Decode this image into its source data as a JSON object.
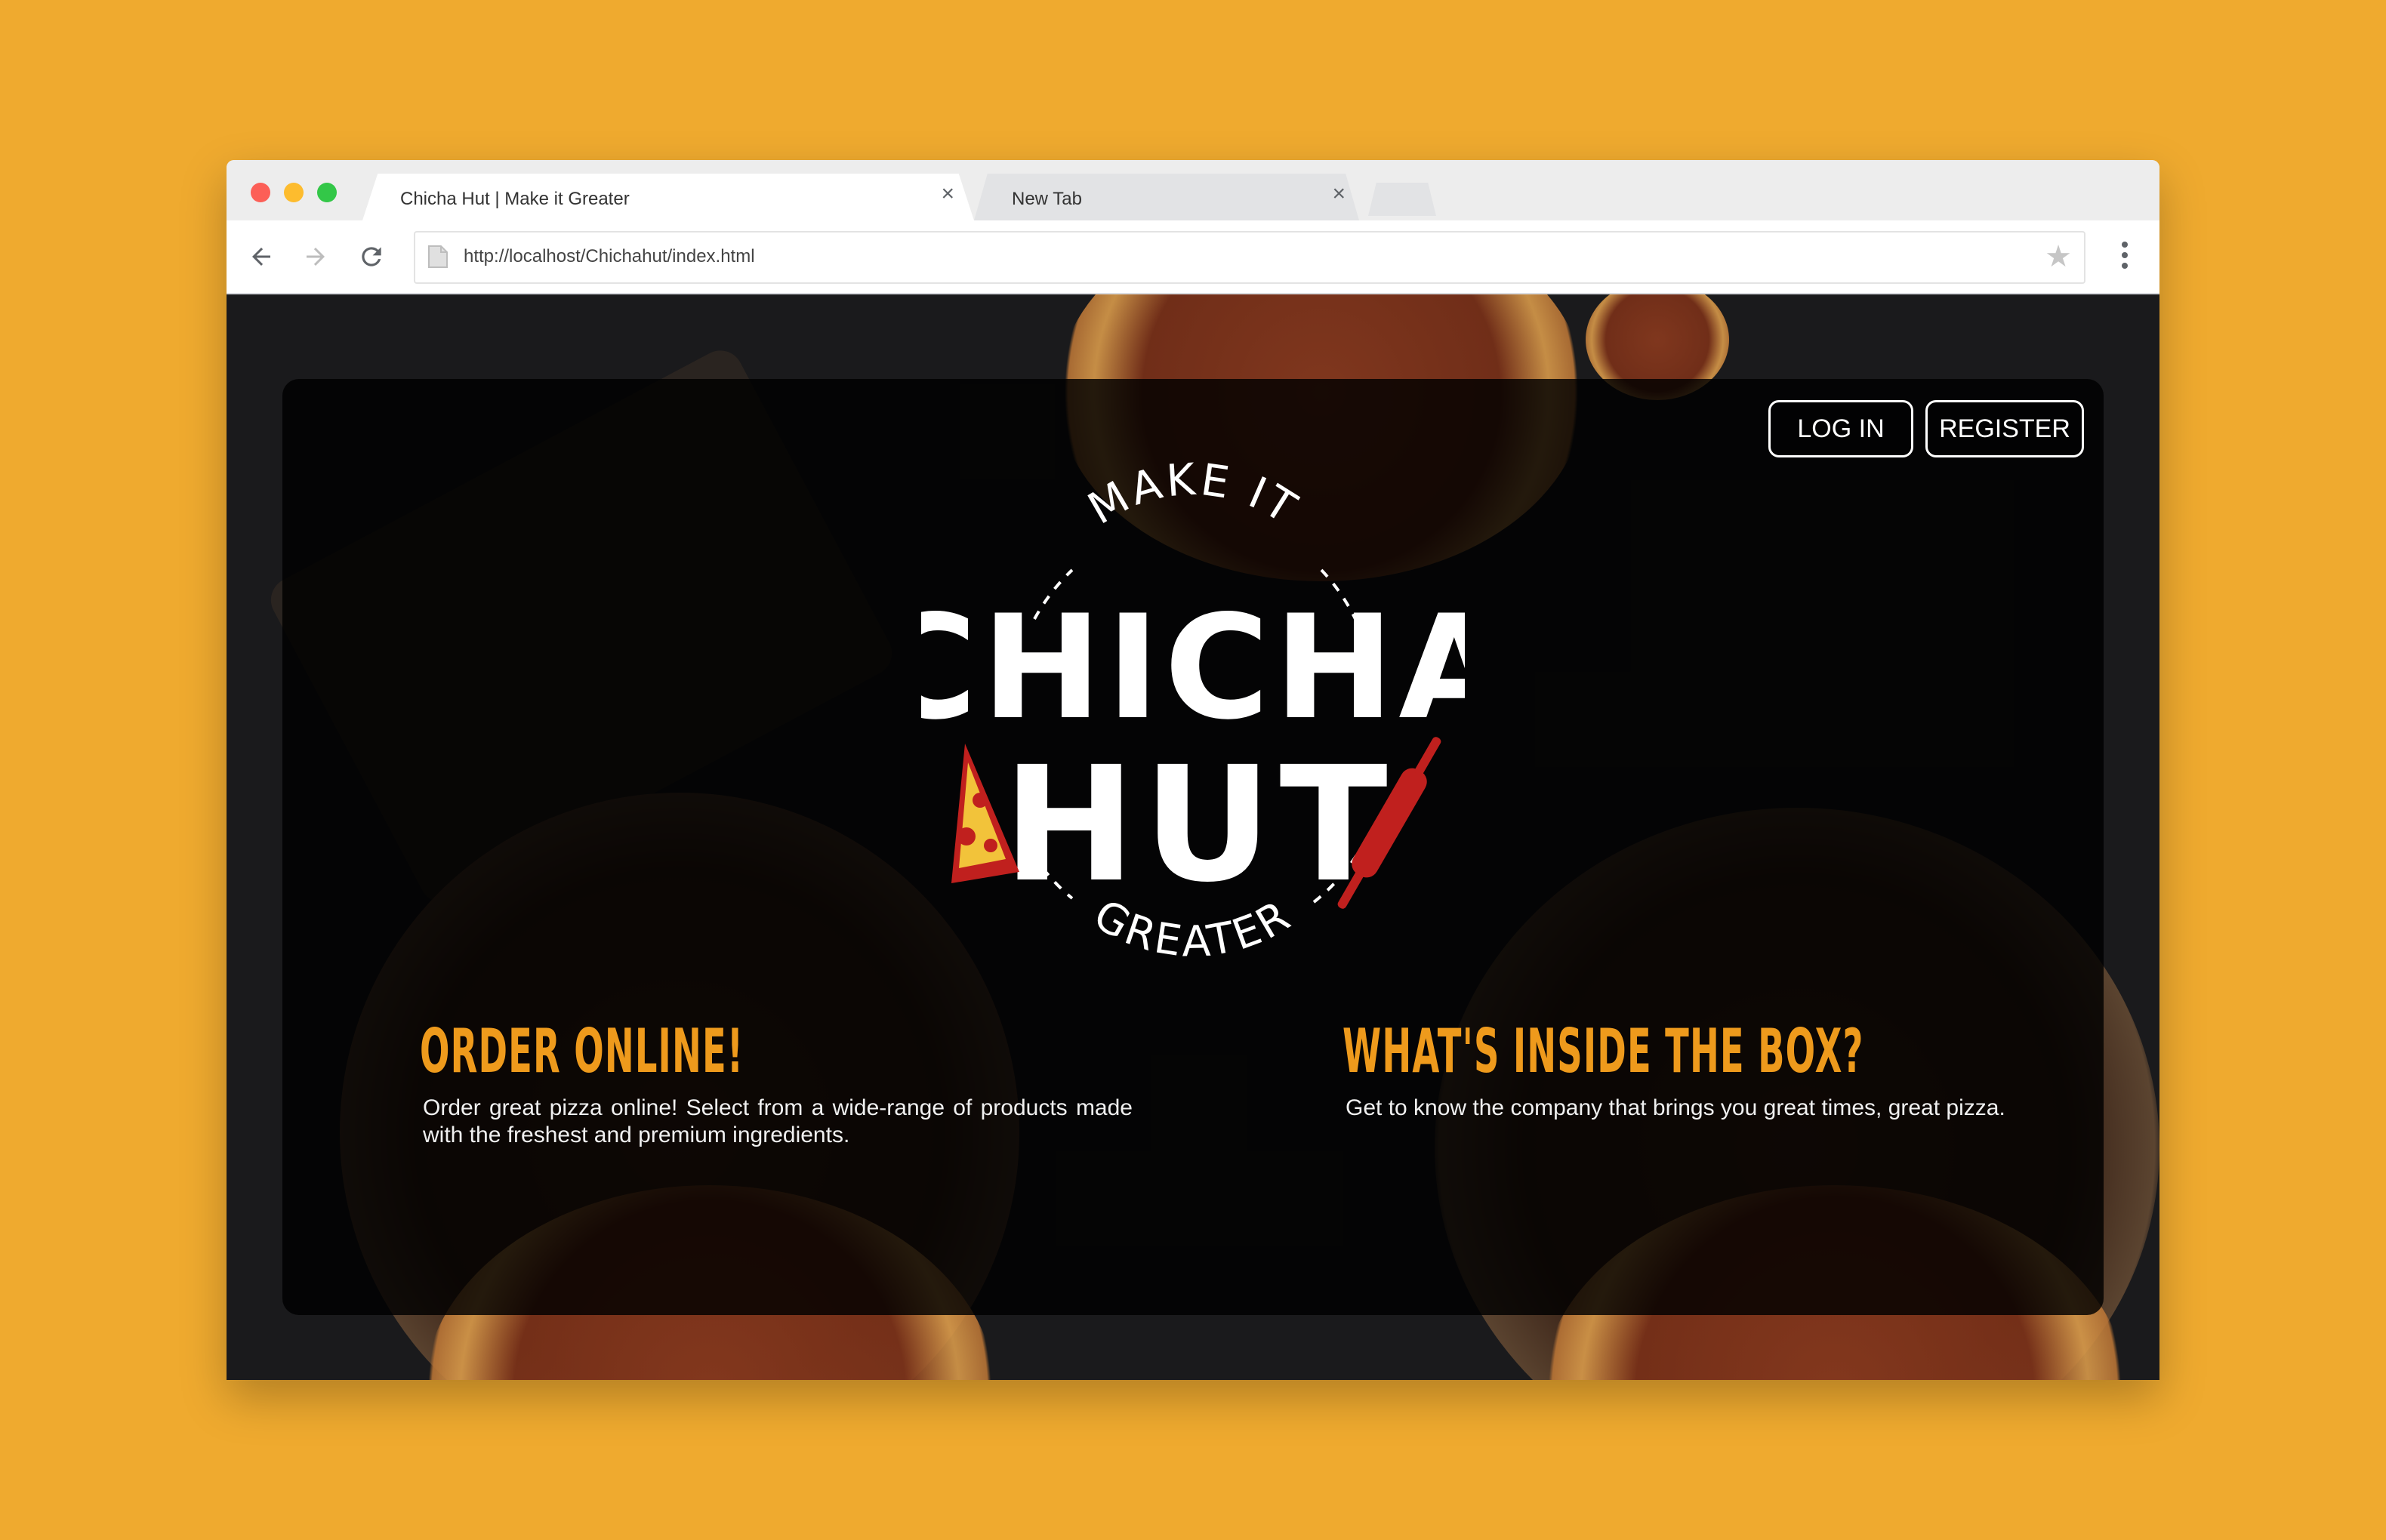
{
  "browser": {
    "tabs": [
      {
        "title": "Chicha Hut | Make it Greater",
        "close": "×",
        "active": true
      },
      {
        "title": "New Tab",
        "close": "×",
        "active": false
      }
    ],
    "url": "http://localhost/Chichahut/index.html"
  },
  "site": {
    "auth": {
      "login_label": "LOG IN",
      "register_label": "REGISTER"
    },
    "logo": {
      "top": "MAKE IT",
      "line1": "CHICHA",
      "line2": "HUT",
      "bottom": "GREATER"
    },
    "order": {
      "title": "ORDER ONLINE!",
      "text": "Order great pizza online! Select from a wide-range of products made with the freshest and premium ingredients."
    },
    "about": {
      "title": "WHAT'S INSIDE THE BOX?",
      "text": "Get to know the company that brings you great times, great pizza."
    },
    "colors": {
      "background": "#EFAA2F",
      "accent": "#EE9A1C",
      "logo_red": "#C0201E"
    }
  }
}
